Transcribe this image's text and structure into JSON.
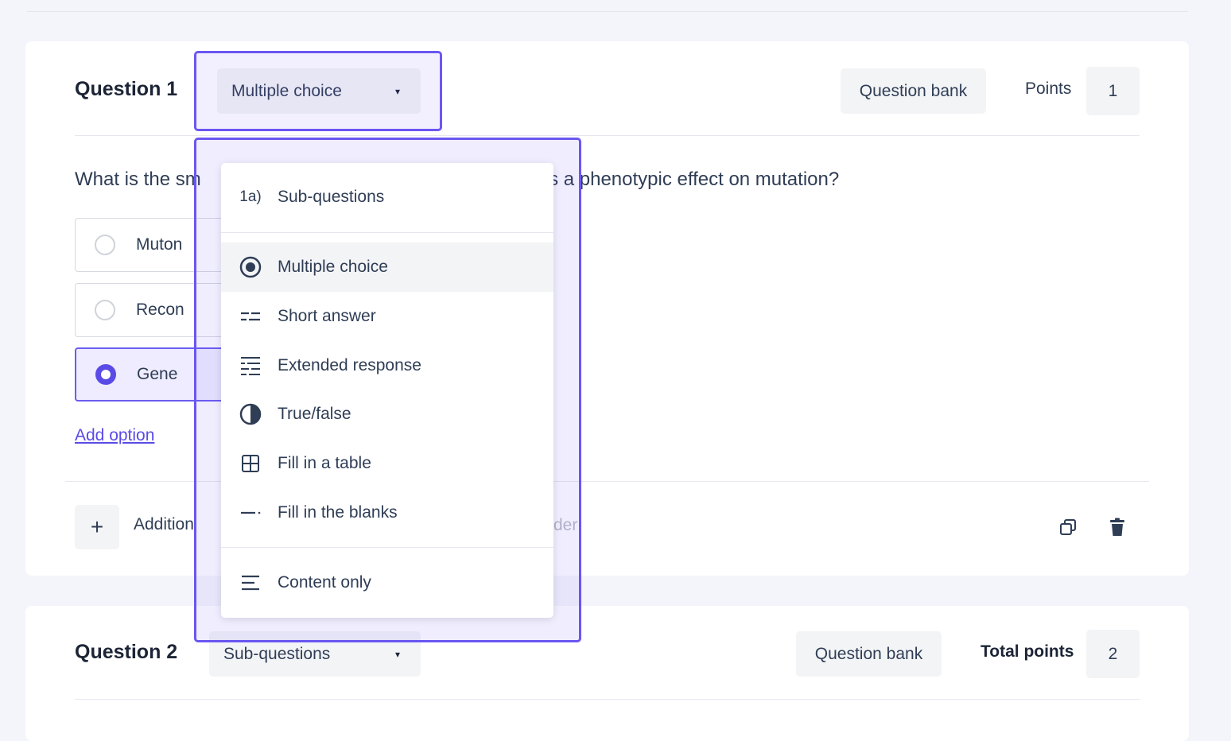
{
  "question1": {
    "title": "Question 1",
    "type_select": {
      "value": "Multiple choice",
      "caret": "▾"
    },
    "question_bank_label": "Question bank",
    "points_label": "Points",
    "points_value": "1",
    "question_text_left": "What is the sm",
    "question_text_right": "ces a phenotypic effect on mutation?",
    "options": [
      {
        "label": "Muton",
        "selected": false
      },
      {
        "label": "Recon",
        "selected": false
      },
      {
        "label": "Gene",
        "selected": true
      }
    ],
    "add_option_label": "Add option",
    "plus_label": "+",
    "additional_label": "Addition",
    "muted_suffix": "der"
  },
  "question2": {
    "title": "Question 2",
    "type_select": {
      "value": "Sub-questions",
      "caret": "▾"
    },
    "question_bank_label": "Question bank",
    "points_label": "Total points",
    "points_value": "2"
  },
  "type_menu": {
    "header_item": {
      "icon_text": "1a)",
      "label": "Sub-questions"
    },
    "items": [
      {
        "label": "Multiple choice",
        "icon": "radio-icon",
        "active": true
      },
      {
        "label": "Short answer",
        "icon": "short-answer-icon",
        "active": false
      },
      {
        "label": "Extended response",
        "icon": "extended-response-icon",
        "active": false
      },
      {
        "label": "True/false",
        "icon": "half-circle-icon",
        "active": false
      },
      {
        "label": "Fill in a table",
        "icon": "table-icon",
        "active": false
      },
      {
        "label": "Fill in the blanks",
        "icon": "blank-line-icon",
        "active": false
      }
    ],
    "footer_item": {
      "label": "Content only",
      "icon": "lines-icon"
    }
  },
  "colors": {
    "accent": "#5a4be6",
    "highlight_border": "#6a56f2",
    "text": "#2f3d55"
  }
}
